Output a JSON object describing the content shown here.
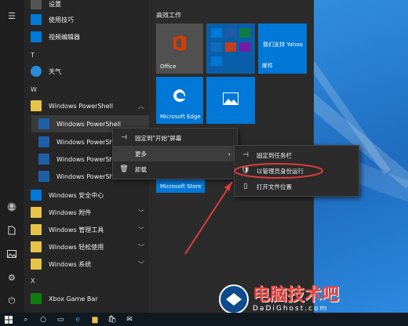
{
  "applist": {
    "top_items": [
      {
        "label": "设置",
        "icon": "gear-icon"
      },
      {
        "label": "使用技巧",
        "icon": "lightbulb-icon"
      },
      {
        "label": "视频编辑器",
        "icon": "video-icon"
      }
    ],
    "letter_t": "T",
    "tianqi": "天气",
    "letter_w": "W",
    "powershell_folder": "Windows PowerShell",
    "powershell_items": [
      "Windows PowerShell",
      "Windows PowerShell",
      "Windows PowerShell",
      "Windows PowerShell"
    ],
    "folders": [
      {
        "label": "Windows 安全中心",
        "icon": "shield-icon"
      },
      {
        "label": "Windows 附件"
      },
      {
        "label": "Windows 管理工具"
      },
      {
        "label": "Windows 轻松使用"
      },
      {
        "label": "Windows 系统"
      }
    ],
    "letter_x": "X",
    "xbox": "Xbox Game Bar"
  },
  "tiles": {
    "group_title": "高效工作",
    "office": "Office",
    "yahoo": "我们支持 Yahoo",
    "mail": "邮件",
    "edge": "Microsoft Edge",
    "store": "Microsoft Store"
  },
  "menu1": {
    "pin_start": "固定到\"开始\"屏幕",
    "more": "更多",
    "uninstall": "卸载"
  },
  "menu2": {
    "pin_taskbar": "固定到任务栏",
    "run_admin": "以管理员身份运行",
    "open_location": "打开文件位置"
  },
  "watermark": {
    "text": "电脑技术吧",
    "sub": "DaDiGhost.com"
  },
  "colors": {
    "accent": "#0078d7",
    "annotation": "#e03a3a",
    "folder": "#e8c34a"
  }
}
